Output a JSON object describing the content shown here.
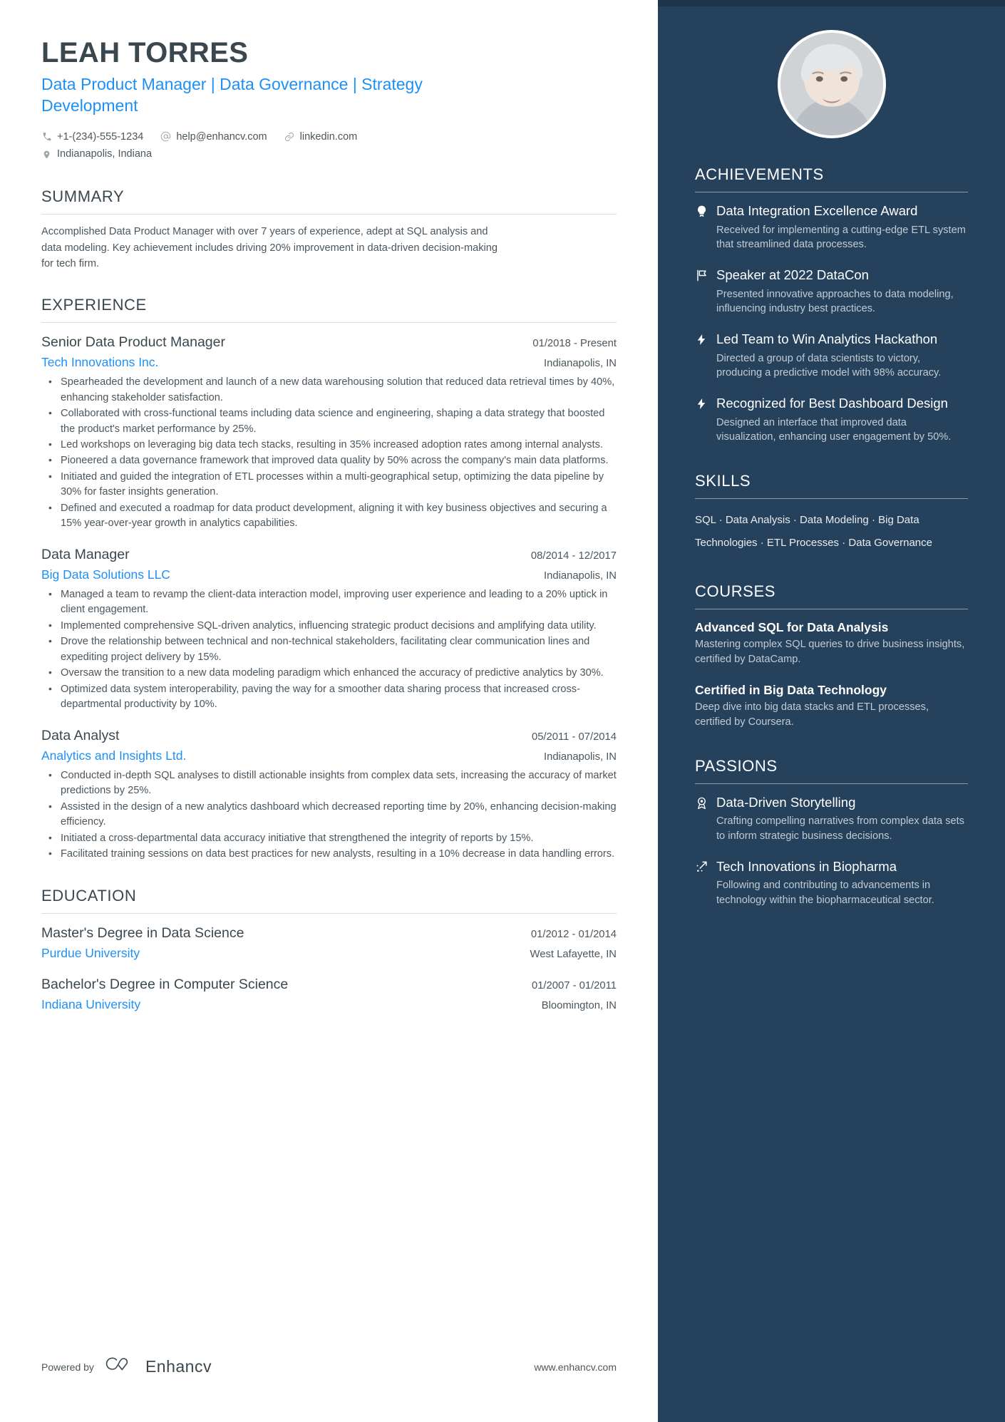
{
  "profile": {
    "name": "LEAH TORRES",
    "headline": "Data Product Manager | Data Governance | Strategy Development",
    "phone": "+1-(234)-555-1234",
    "email": "help@enhancv.com",
    "linkedin": "linkedin.com",
    "location": "Indianapolis, Indiana"
  },
  "summary": {
    "heading": "SUMMARY",
    "text": "Accomplished Data Product Manager with over 7 years of experience, adept at SQL analysis and data modeling. Key achievement includes driving 20% improvement in data-driven decision-making for tech firm."
  },
  "experience": {
    "heading": "EXPERIENCE",
    "items": [
      {
        "title": "Senior Data Product Manager",
        "date": "01/2018 - Present",
        "org": "Tech Innovations Inc.",
        "location": "Indianapolis, IN",
        "bullets": [
          "Spearheaded the development and launch of a new data warehousing solution that reduced data retrieval times by 40%, enhancing stakeholder satisfaction.",
          "Collaborated with cross-functional teams including data science and engineering, shaping a data strategy that boosted the product's market performance by 25%.",
          "Led workshops on leveraging big data tech stacks, resulting in 35% increased adoption rates among internal analysts.",
          "Pioneered a data governance framework that improved data quality by 50% across the company's main data platforms.",
          "Initiated and guided the integration of ETL processes within a multi-geographical setup, optimizing the data pipeline by 30% for faster insights generation.",
          "Defined and executed a roadmap for data product development, aligning it with key business objectives and securing a 15% year-over-year growth in analytics capabilities."
        ]
      },
      {
        "title": "Data Manager",
        "date": "08/2014 - 12/2017",
        "org": "Big Data Solutions LLC",
        "location": "Indianapolis, IN",
        "bullets": [
          "Managed a team to revamp the client-data interaction model, improving user experience and leading to a 20% uptick in client engagement.",
          "Implemented comprehensive SQL-driven analytics, influencing strategic product decisions and amplifying data utility.",
          "Drove the relationship between technical and non-technical stakeholders, facilitating clear communication lines and expediting project delivery by 15%.",
          "Oversaw the transition to a new data modeling paradigm which enhanced the accuracy of predictive analytics by 30%.",
          "Optimized data system interoperability, paving the way for a smoother data sharing process that increased cross-departmental productivity by 10%."
        ]
      },
      {
        "title": "Data Analyst",
        "date": "05/2011 - 07/2014",
        "org": "Analytics and Insights Ltd.",
        "location": "Indianapolis, IN",
        "bullets": [
          "Conducted in-depth SQL analyses to distill actionable insights from complex data sets, increasing the accuracy of market predictions by 25%.",
          "Assisted in the design of a new analytics dashboard which decreased reporting time by 20%, enhancing decision-making efficiency.",
          "Initiated a cross-departmental data accuracy initiative that strengthened the integrity of reports by 15%.",
          "Facilitated training sessions on data best practices for new analysts, resulting in a 10% decrease in data handling errors."
        ]
      }
    ]
  },
  "education": {
    "heading": "EDUCATION",
    "items": [
      {
        "title": "Master's Degree in Data Science",
        "date": "01/2012 - 01/2014",
        "org": "Purdue University",
        "location": "West Lafayette, IN"
      },
      {
        "title": "Bachelor's Degree in Computer Science",
        "date": "01/2007 - 01/2011",
        "org": "Indiana University",
        "location": "Bloomington, IN"
      }
    ]
  },
  "achievements": {
    "heading": "ACHIEVEMENTS",
    "items": [
      {
        "icon": "award-bulb-icon",
        "title": "Data Integration Excellence Award",
        "desc": "Received for implementing a cutting-edge ETL system that streamlined data processes."
      },
      {
        "icon": "flag-icon",
        "title": "Speaker at 2022 DataCon",
        "desc": "Presented innovative approaches to data modeling, influencing industry best practices."
      },
      {
        "icon": "bolt-icon",
        "title": "Led Team to Win Analytics Hackathon",
        "desc": "Directed a group of data scientists to victory, producing a predictive model with 98% accuracy."
      },
      {
        "icon": "bolt-icon",
        "title": "Recognized for Best Dashboard Design",
        "desc": "Designed an interface that improved data visualization, enhancing user engagement by 50%."
      }
    ]
  },
  "skills": {
    "heading": "SKILLS",
    "items": [
      "SQL",
      "Data Analysis",
      "Data Modeling",
      "Big Data Technologies",
      "ETL Processes",
      "Data Governance"
    ],
    "separator": "·"
  },
  "courses": {
    "heading": "COURSES",
    "items": [
      {
        "title": "Advanced SQL for Data Analysis",
        "desc": "Mastering complex SQL queries to drive business insights, certified by DataCamp."
      },
      {
        "title": "Certified in Big Data Technology",
        "desc": "Deep dive into big data stacks and ETL processes, certified by Coursera."
      }
    ]
  },
  "passions": {
    "heading": "PASSIONS",
    "items": [
      {
        "icon": "medal-icon",
        "title": "Data-Driven Storytelling",
        "desc": "Crafting compelling narratives from complex data sets to inform strategic business decisions."
      },
      {
        "icon": "rocket-icon",
        "title": "Tech Innovations in Biopharma",
        "desc": "Following and contributing to advancements in technology within the biopharmaceutical sector."
      }
    ]
  },
  "footer": {
    "powered_label": "Powered by",
    "brand": "Enhancv",
    "website": "www.enhancv.com"
  }
}
